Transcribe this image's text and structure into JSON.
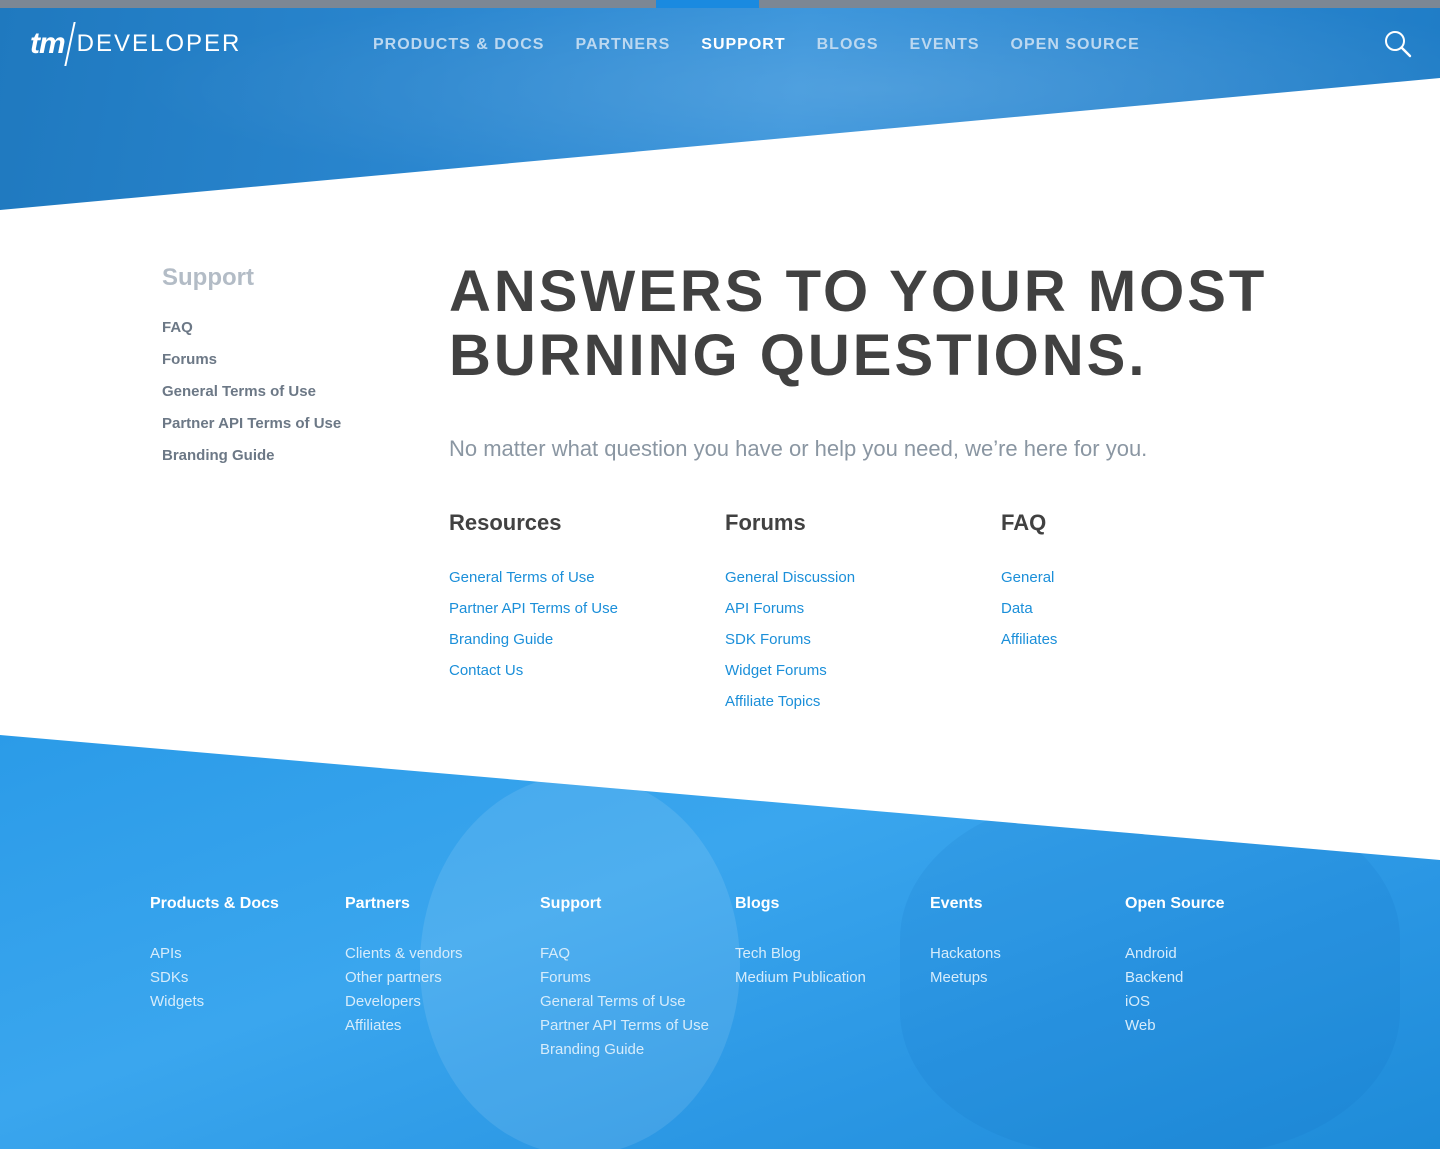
{
  "header": {
    "logo_tm": "tm",
    "logo_text": "DEVELOPER",
    "nav": [
      {
        "label": "Products & Docs"
      },
      {
        "label": "Partners"
      },
      {
        "label": "Support"
      },
      {
        "label": "Blogs"
      },
      {
        "label": "Events"
      },
      {
        "label": "Open Source"
      }
    ],
    "active_nav": "Support",
    "search_icon": "search-icon"
  },
  "sidebar": {
    "title": "Support",
    "items": [
      "FAQ",
      "Forums",
      "General Terms of Use",
      "Partner API Terms of Use",
      "Branding Guide"
    ]
  },
  "main": {
    "headline_line1": "Answers to your most",
    "headline_line2": "burning questions.",
    "lead": "No matter what question you have or help you need, we’re here for you.",
    "columns": [
      {
        "title": "Resources",
        "links": [
          "General Terms of Use",
          "Partner API Terms of Use",
          "Branding Guide",
          "Contact Us"
        ]
      },
      {
        "title": "Forums",
        "links": [
          "General Discussion",
          "API Forums",
          "SDK Forums",
          "Widget Forums",
          "Affiliate Topics"
        ]
      },
      {
        "title": "FAQ",
        "links": [
          "General",
          "Data",
          "Affiliates"
        ]
      }
    ]
  },
  "footer": {
    "columns": [
      {
        "title": "Products & Docs",
        "links": [
          "APIs",
          "SDKs",
          "Widgets"
        ]
      },
      {
        "title": "Partners",
        "links": [
          "Clients & vendors",
          "Other partners",
          "Developers",
          "Affiliates"
        ]
      },
      {
        "title": "Support",
        "links": [
          "FAQ",
          "Forums",
          "General Terms of Use",
          "Partner API Terms of Use",
          "Branding Guide"
        ]
      },
      {
        "title": "Blogs",
        "links": [
          "Tech Blog",
          "Medium Publication"
        ]
      },
      {
        "title": "Events",
        "links": [
          "Hackatons",
          "Meetups"
        ]
      },
      {
        "title": "Open Source",
        "links": [
          "Android",
          "Backend",
          "iOS",
          "Web"
        ]
      }
    ]
  },
  "colors": {
    "brand_blue": "#1f79bf",
    "link_blue": "#1b8fd9",
    "heading_dark": "#414141",
    "sidebar_gray": "#6c7886"
  }
}
